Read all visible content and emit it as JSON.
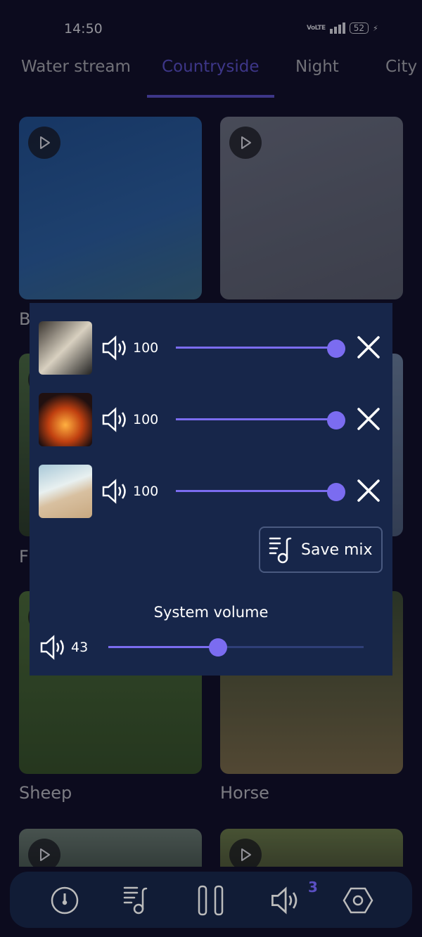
{
  "status": {
    "time": "14:50",
    "network": "VoLTE",
    "battery": "52"
  },
  "tabs": [
    {
      "label": "Water stream"
    },
    {
      "label": "Countryside",
      "active": true
    },
    {
      "label": "Night"
    },
    {
      "label": "City"
    }
  ],
  "cards": [
    {
      "label": "B"
    },
    {
      "label": ""
    },
    {
      "label": "F"
    },
    {
      "label": ""
    },
    {
      "label": "Sheep"
    },
    {
      "label": "Horse"
    },
    {
      "label": ""
    },
    {
      "label": ""
    }
  ],
  "mix": {
    "items": [
      {
        "thumb": "piano",
        "volume": "100",
        "level": 100
      },
      {
        "thumb": "campfire",
        "volume": "100",
        "level": 100
      },
      {
        "thumb": "beach",
        "volume": "100",
        "level": 100
      }
    ],
    "save_label": "Save mix",
    "system_volume_label": "System volume",
    "system_volume": "43",
    "system_level": 43
  },
  "nav": {
    "badge": "3",
    "icons": [
      "timer-icon",
      "playlist-icon",
      "pause-icon",
      "volume-icon",
      "settings-icon"
    ]
  },
  "colors": {
    "accent": "#7b6cf0",
    "tab_active": "#5a4fc2",
    "panel": "#17264a",
    "nav": "#111c36"
  }
}
